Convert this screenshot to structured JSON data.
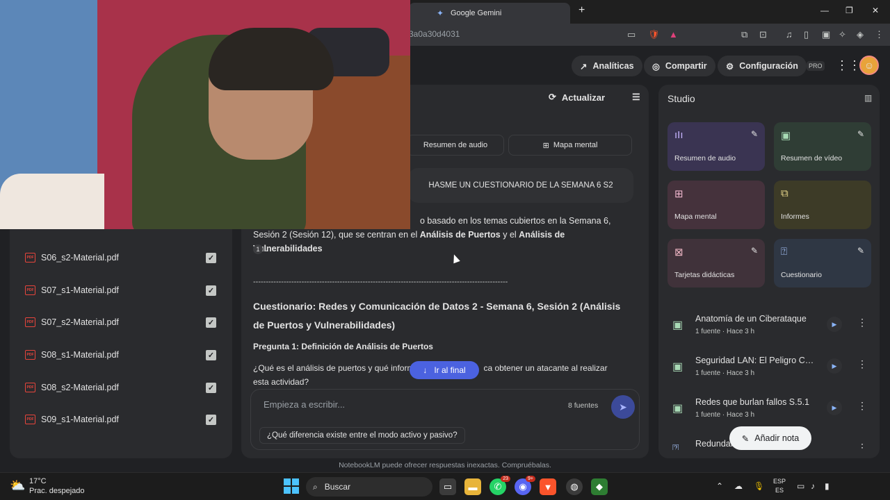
{
  "browser": {
    "tab_title": "Google Gemini",
    "url_fragment": "3a0a30d4031"
  },
  "header": {
    "analytics": "Analíticas",
    "share": "Compartir",
    "settings": "Configuración",
    "pro_badge": "PRO"
  },
  "sources": {
    "items": [
      {
        "name": "S06_s2-Material.pdf"
      },
      {
        "name": "S07_s1-Material.pdf"
      },
      {
        "name": "S07_s2-Material.pdf"
      },
      {
        "name": "S08_s1-Material.pdf"
      },
      {
        "name": "S08_s2-Material.pdf"
      },
      {
        "name": "S09_s1-Material.pdf"
      }
    ]
  },
  "chat": {
    "refresh": "Actualizar",
    "chip_audio": "Resumen de audio",
    "chip_mindmap": "Mapa mental",
    "user_message": "HASME UN CUESTIONARIO DE LA SEMANA 6 S2",
    "response_line1": "o basado en los temas cubiertos en la Semana 6,",
    "response_line2_a": "Sesión 2 (Sesión 12), que se centran en el ",
    "response_bold1": "Análisis de Puertos",
    "response_line2_b": " y el ",
    "response_bold2": "Análisis de Vulnerabilidades",
    "citation": "1",
    "divider": "----------------------------------------------------------------------------------------------------",
    "quiz_title": "Cuestionario: Redes y Comunicación de Datos 2 - Semana 6, Sesión 2 (Análisis de Puertos y Vulnerabilidades)",
    "question1_title": "Pregunta 1: Definición de Análisis de Puertos",
    "question1_a": "¿Qué es el análisis de puertos y qué inform",
    "question1_b": "ca obtener un atacante al realizar",
    "question1_c": "esta actividad?",
    "goto_end": "Ir al final",
    "composer_placeholder": "Empieza a escribir...",
    "source_count": "8 fuentes",
    "suggestion": "¿Qué diferencia existe entre el modo activo y pasivo?"
  },
  "studio": {
    "title": "Studio",
    "tiles": [
      {
        "label": "Resumen de audio",
        "icon": "audio-wave-icon"
      },
      {
        "label": "Resumen de vídeo",
        "icon": "video-icon"
      },
      {
        "label": "Mapa mental",
        "icon": "mindmap-icon"
      },
      {
        "label": "Informes",
        "icon": "report-icon"
      },
      {
        "label": "Tarjetas didácticas",
        "icon": "flashcards-icon"
      },
      {
        "label": "Cuestionario",
        "icon": "quiz-icon"
      }
    ],
    "notes": [
      {
        "title": "Anatomía de un Ciberataque",
        "meta": "1 fuente · Hace 3 h"
      },
      {
        "title": "Seguridad LAN: El Peligro Cer...",
        "meta": "1 fuente · Hace 3 h"
      },
      {
        "title": "Redes que burlan fallos S.5.1",
        "meta": "1 fuente · Hace 3 h"
      },
      {
        "title": "Redundan",
        "meta": ""
      }
    ],
    "add_note": "Añadir nota"
  },
  "footer": {
    "disclaimer": "NotebookLM puede ofrecer respuestas inexactas. Compruébalas."
  },
  "taskbar": {
    "temp": "17°C",
    "weather": "Prac. despejado",
    "search": "Buscar",
    "whatsapp_badge": "23",
    "discord_badge": "9+",
    "lang1": "ESP",
    "lang2": "ES"
  }
}
